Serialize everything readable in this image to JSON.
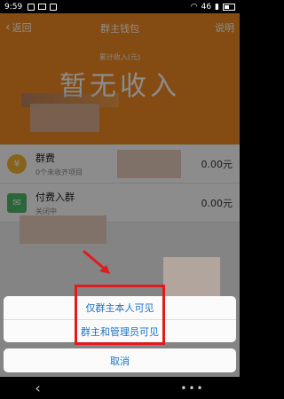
{
  "status_bar": {
    "time": "9:59",
    "network": "46"
  },
  "nav": {
    "back_label": "返回",
    "title": "群主钱包",
    "help_label": "说明"
  },
  "summary": {
    "cumulative_label": "累计收入(元)",
    "no_income_text": "暂无收入"
  },
  "items": [
    {
      "icon": "coin-icon",
      "title": "群费",
      "subtitle": "0个未收齐项目",
      "amount": "0.00元"
    },
    {
      "icon": "ticket-icon",
      "title": "付费入群",
      "subtitle": "关闭中",
      "amount": "0.00元"
    }
  ],
  "action_sheet": {
    "option1": "仅群主本人可见",
    "option2": "群主和管理员可见",
    "cancel": "取消"
  },
  "colors": {
    "header": "#f08a24",
    "accent": "#1a73c8",
    "highlight": "#e01b1b"
  }
}
